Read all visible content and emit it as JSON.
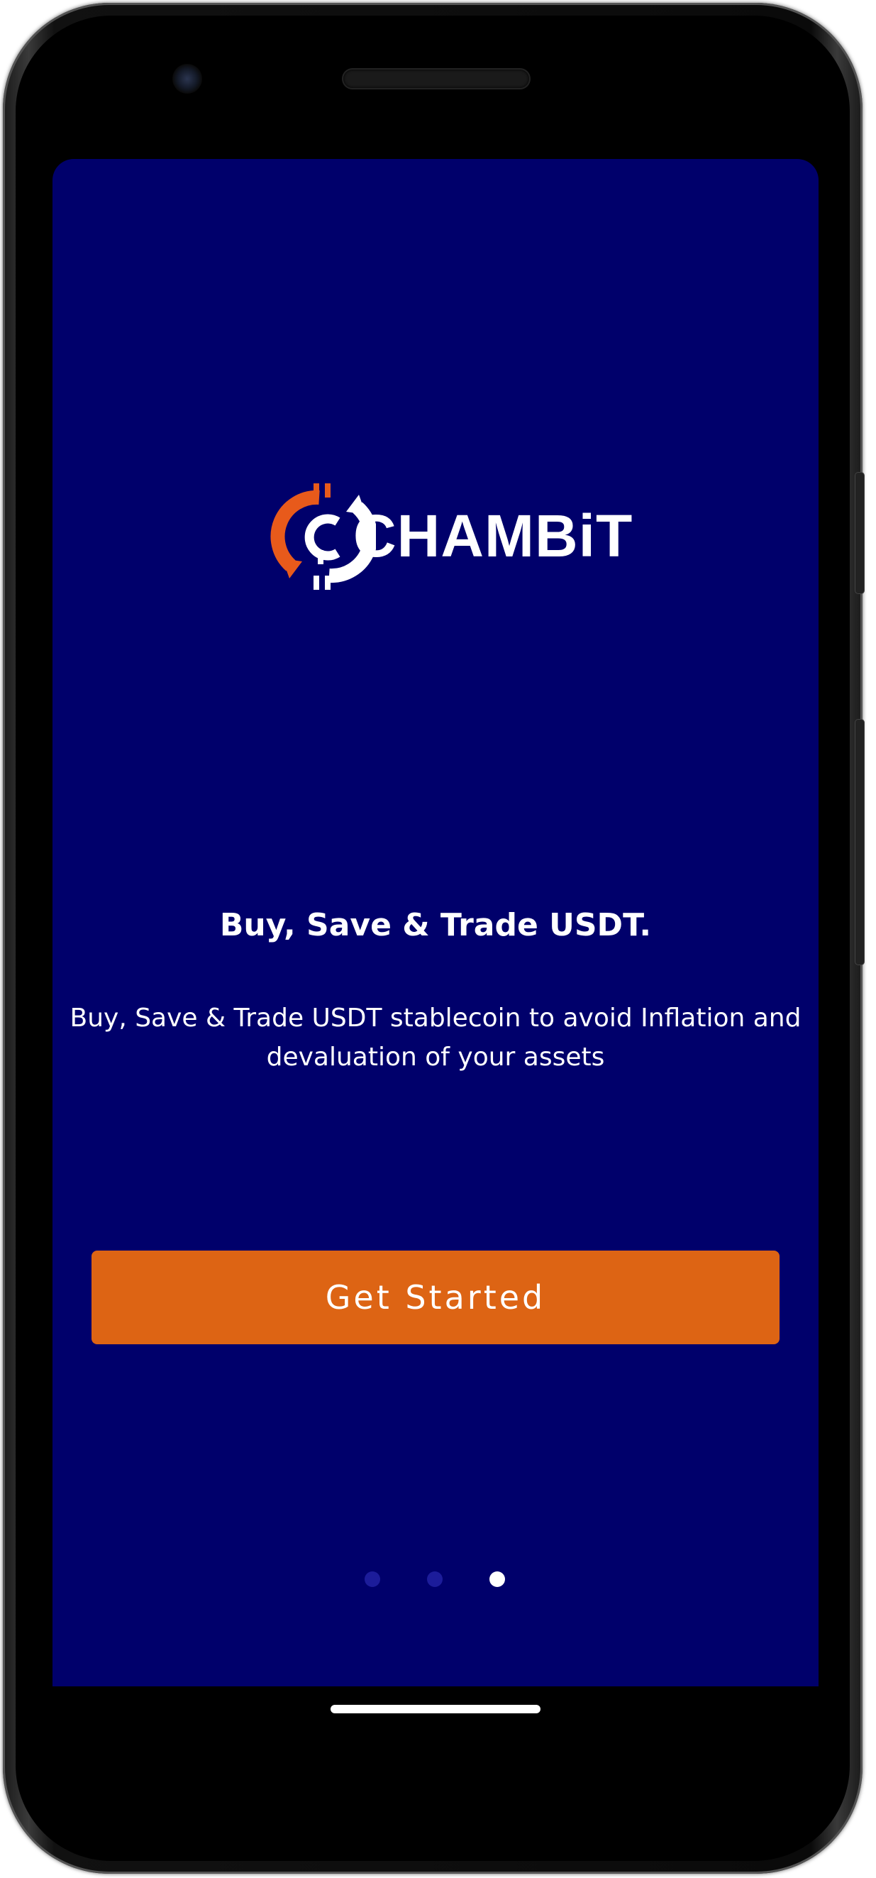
{
  "app": {
    "brand_name": "CHAMBiT",
    "background_color": "#00006b",
    "accent_color": "#dd6414"
  },
  "onboarding": {
    "headline": "Buy, Save & Trade USDT.",
    "description": "Buy, Save & Trade USDT stablecoin to avoid Inflation and devaluation of your assets",
    "cta_label": "Get Started",
    "pager": {
      "total": 3,
      "active_index": 2
    }
  },
  "icons": {
    "logo": "chambit-logo-icon"
  }
}
